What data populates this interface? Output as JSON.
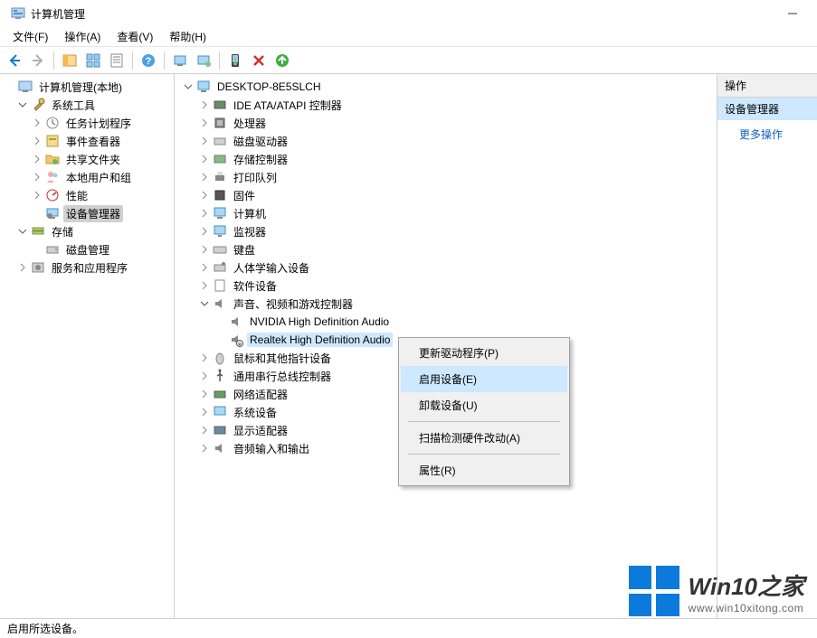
{
  "window": {
    "title": "计算机管理"
  },
  "menubar": {
    "file": "文件(F)",
    "action": "操作(A)",
    "view": "查看(V)",
    "help": "帮助(H)"
  },
  "left_tree": {
    "root": "计算机管理(本地)",
    "system_tools": "系统工具",
    "task_scheduler": "任务计划程序",
    "event_viewer": "事件查看器",
    "shared_folders": "共享文件夹",
    "local_users": "本地用户和组",
    "performance": "性能",
    "device_manager": "设备管理器",
    "storage": "存储",
    "disk_management": "磁盘管理",
    "services_apps": "服务和应用程序"
  },
  "center_tree": {
    "root": "DESKTOP-8E5SLCH",
    "ide": "IDE ATA/ATAPI 控制器",
    "processors": "处理器",
    "disk_drives": "磁盘驱动器",
    "storage_ctl": "存储控制器",
    "print_queues": "打印队列",
    "firmware": "固件",
    "computer": "计算机",
    "monitors": "监视器",
    "keyboards": "键盘",
    "hid": "人体学输入设备",
    "software_devices": "软件设备",
    "sound": "声音、视频和游戏控制器",
    "nvidia_audio": "NVIDIA High Definition Audio",
    "realtek_audio": "Realtek High Definition Audio",
    "mice": "鼠标和其他指针设备",
    "usb": "通用串行总线控制器",
    "network": "网络适配器",
    "system_devices": "系统设备",
    "display": "显示适配器",
    "audio_io": "音频输入和输出"
  },
  "right_panel": {
    "header": "操作",
    "section": "设备管理器",
    "more_actions": "更多操作"
  },
  "context_menu": {
    "update_driver": "更新驱动程序(P)",
    "enable_device": "启用设备(E)",
    "uninstall": "卸载设备(U)",
    "scan_hardware": "扫描检测硬件改动(A)",
    "properties": "属性(R)"
  },
  "statusbar": {
    "text": "启用所选设备。"
  },
  "watermark": {
    "title": "Win10之家",
    "url": "www.win10xitong.com"
  }
}
